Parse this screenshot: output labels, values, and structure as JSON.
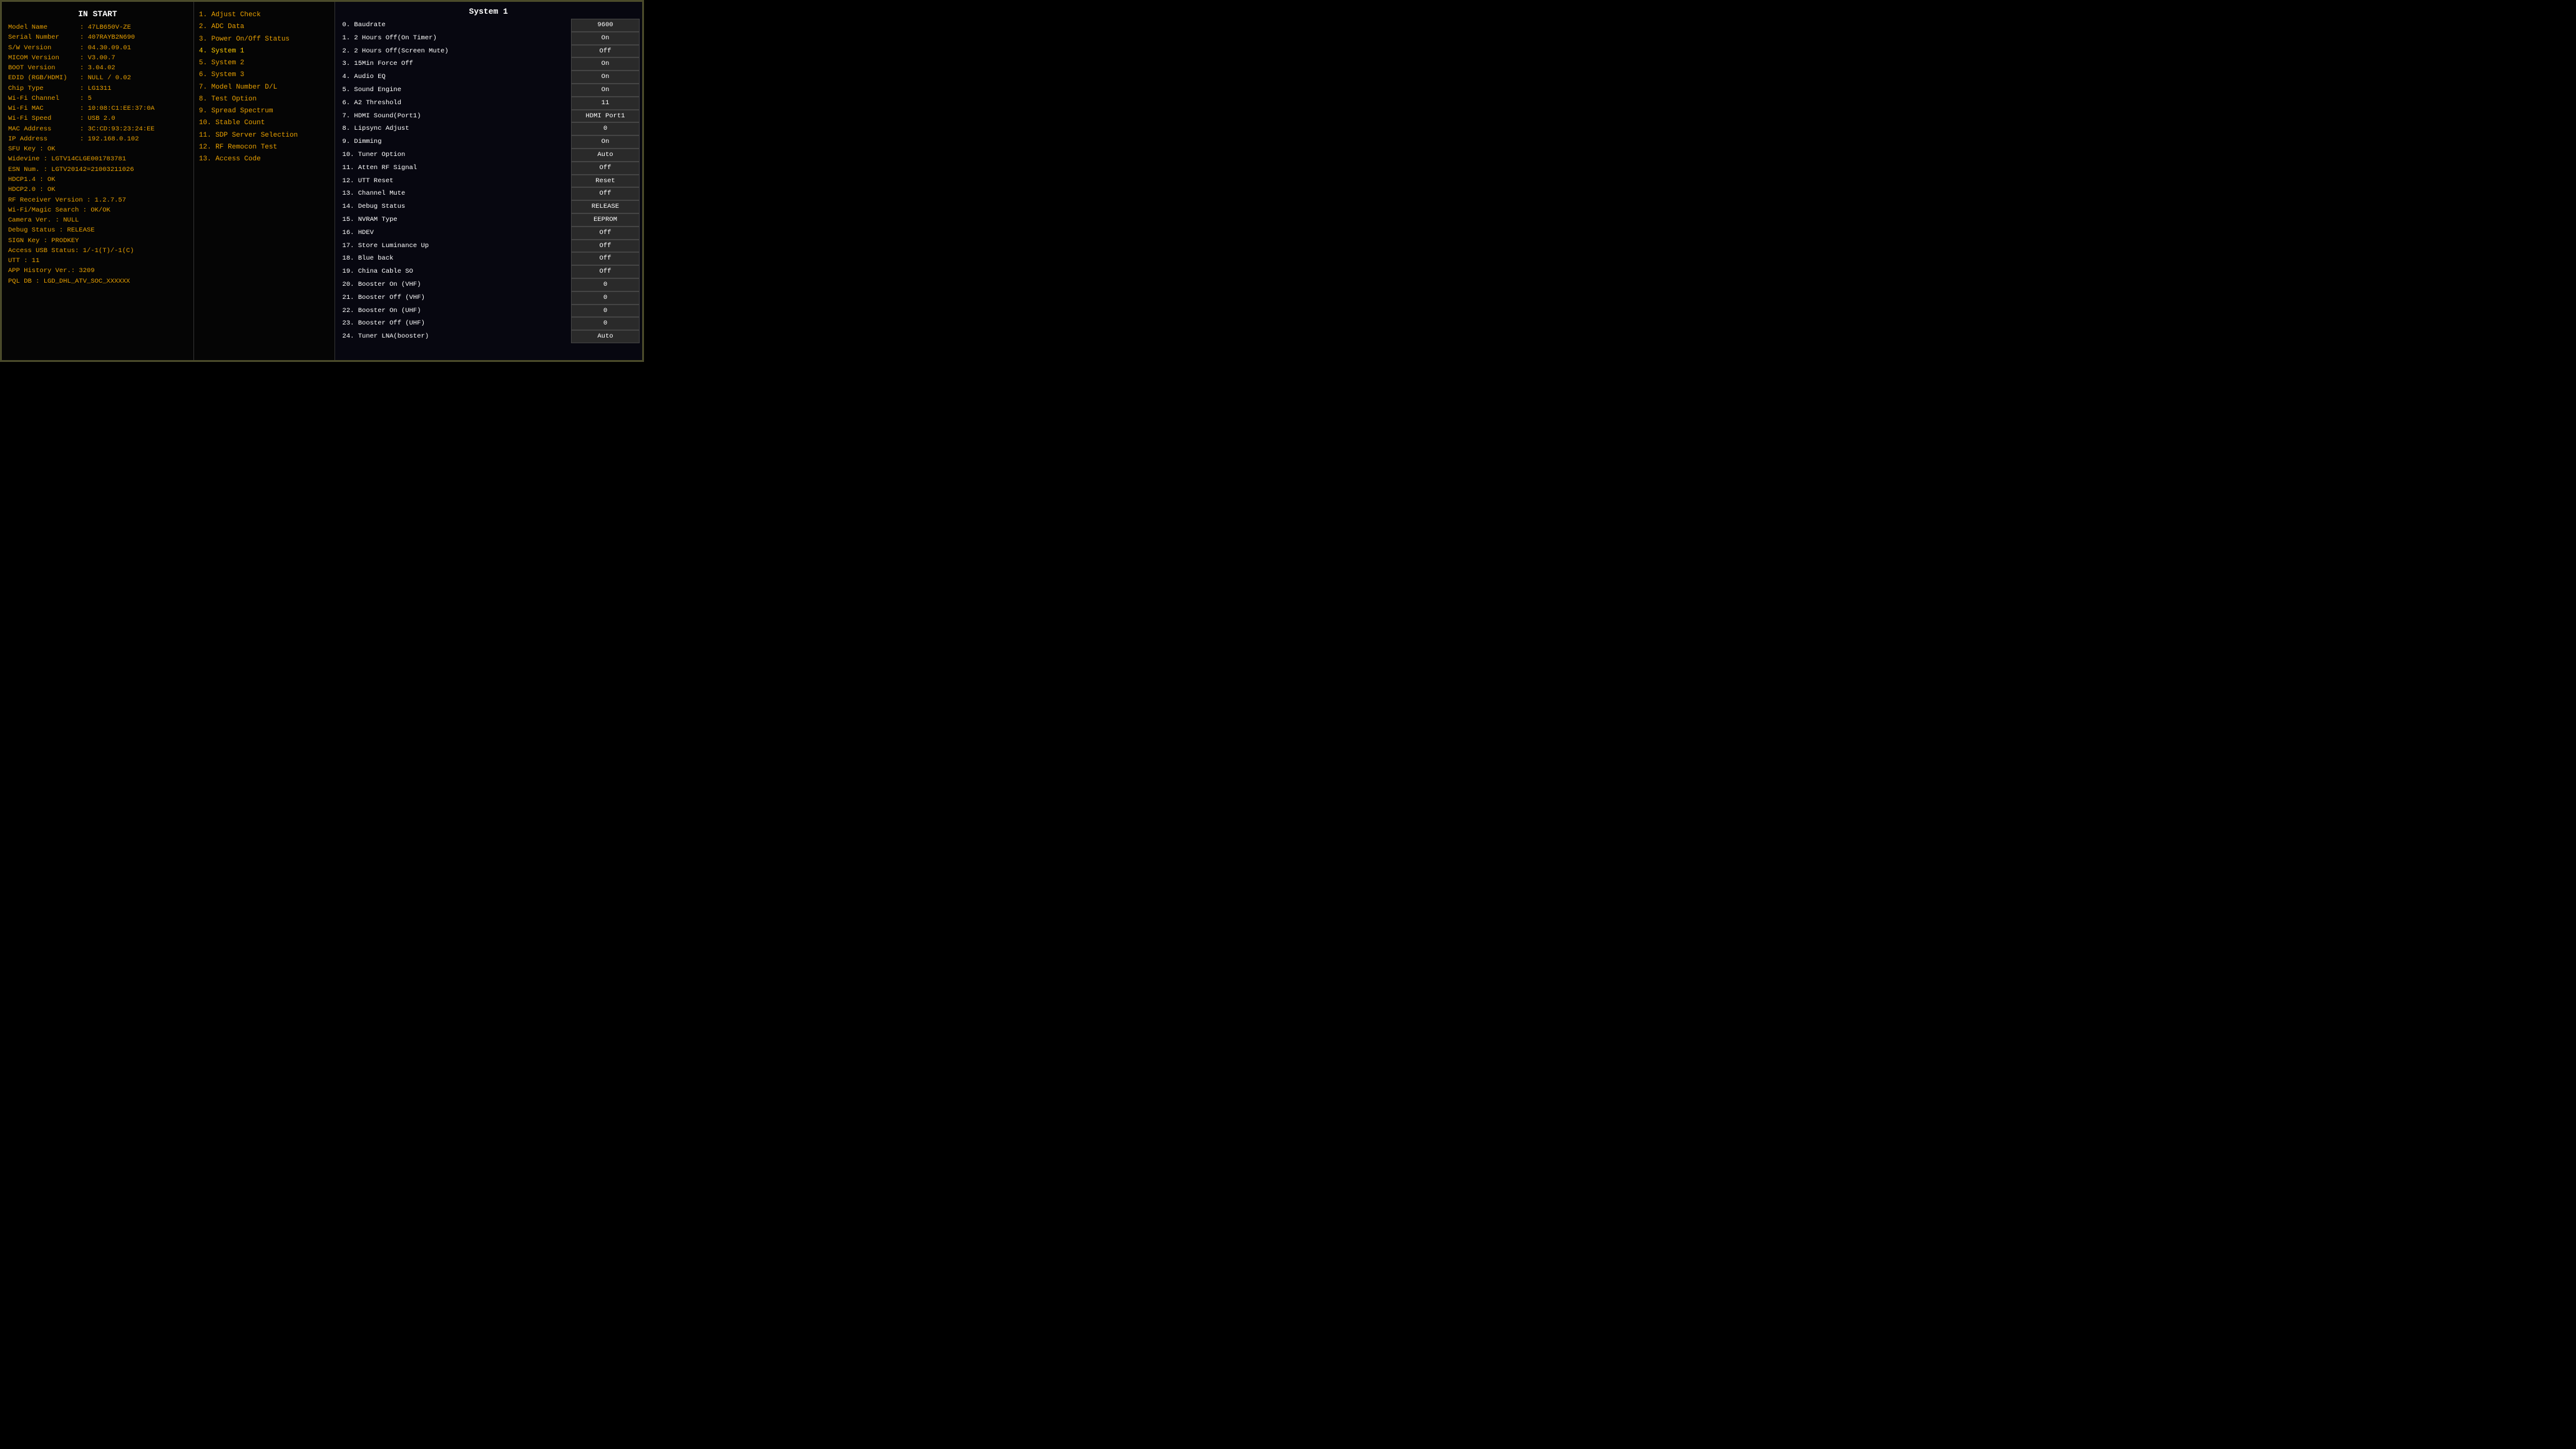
{
  "left": {
    "title": "IN START",
    "rows": [
      {
        "label": "Model Name",
        "value": ": 47LB650V-ZE"
      },
      {
        "label": "Serial Number",
        "value": ": 407RAYB2N690"
      },
      {
        "label": "S/W Version",
        "value": ": 04.30.09.01"
      },
      {
        "label": "MICOM Version",
        "value": ": V3.00.7"
      },
      {
        "label": "BOOT Version",
        "value": ": 3.04.02"
      },
      {
        "label": "EDID (RGB/HDMI)",
        "value": ": NULL / 0.02"
      },
      {
        "label": "Chip Type",
        "value": ": LG1311"
      },
      {
        "label": "Wi-Fi Channel",
        "value": ": 5"
      },
      {
        "label": "Wi-Fi MAC",
        "value": ": 10:08:C1:EE:37:0A"
      },
      {
        "label": "Wi-Fi Speed",
        "value": ": USB 2.0"
      },
      {
        "label": "MAC Address",
        "value": ": 3C:CD:93:23:24:EE"
      },
      {
        "label": "IP Address",
        "value": ": 192.168.0.102"
      }
    ],
    "singles": [
      "SFU Key : OK",
      "Widevine : LGTV14CLGE001783781",
      "ESN Num. : LGTV20142=21003211026",
      "HDCP1.4        : OK",
      "HDCP2.0        : OK",
      "RF Receiver Version  : 1.2.7.57",
      "Wi-Fi/Magic Search  : OK/OK",
      "Camera Ver.    : NULL",
      "Debug Status   : RELEASE",
      "SIGN Key       : PRODKEY",
      "Access USB Status: 1/-1(T)/-1(C)",
      "UTT : 11",
      "APP History Ver.: 3209",
      "PQL DB : LGD_DHL_ATV_SOC_XXXXXX"
    ]
  },
  "middle": {
    "items": [
      {
        "num": "1",
        "label": ". Adjust Check",
        "selected": false
      },
      {
        "num": "2",
        "label": ". ADC Data",
        "selected": false
      },
      {
        "num": "3",
        "label": ". Power On/Off Status",
        "selected": false
      },
      {
        "num": "4",
        "label": ". System 1",
        "selected": true
      },
      {
        "num": "5",
        "label": ". System 2",
        "selected": false
      },
      {
        "num": "6",
        "label": ". System 3",
        "selected": false
      },
      {
        "num": "7",
        "label": ". Model Number D/L",
        "selected": false
      },
      {
        "num": "8",
        "label": ". Test Option",
        "selected": false
      },
      {
        "num": "9",
        "label": ". Spread Spectrum",
        "selected": false
      },
      {
        "num": "10",
        "label": ". Stable Count",
        "selected": false
      },
      {
        "num": "11",
        "label": ". SDP Server Selection",
        "selected": false
      },
      {
        "num": "12",
        "label": ". RF Remocon Test",
        "selected": false
      },
      {
        "num": "13",
        "label": ". Access Code",
        "selected": false
      }
    ]
  },
  "right": {
    "title": "System 1",
    "rows": [
      {
        "label": "0. Baudrate",
        "value": "9600"
      },
      {
        "label": "1. 2 Hours Off(On Timer)",
        "value": "On"
      },
      {
        "label": "2. 2 Hours Off(Screen Mute)",
        "value": "Off"
      },
      {
        "label": "3. 15Min Force Off",
        "value": "On"
      },
      {
        "label": "4. Audio EQ",
        "value": "On"
      },
      {
        "label": "5. Sound Engine",
        "value": "On"
      },
      {
        "label": "6. A2 Threshold",
        "value": "11"
      },
      {
        "label": "7. HDMI Sound(Port1)",
        "value": "HDMI Port1"
      },
      {
        "label": "8. Lipsync Adjust",
        "value": "0"
      },
      {
        "label": "9. Dimming",
        "value": "On"
      },
      {
        "label": "10. Tuner Option",
        "value": "Auto"
      },
      {
        "label": "11. Atten RF Signal",
        "value": "Off"
      },
      {
        "label": "12. UTT Reset",
        "value": "Reset"
      },
      {
        "label": "13. Channel Mute",
        "value": "Off"
      },
      {
        "label": "14. Debug Status",
        "value": "RELEASE"
      },
      {
        "label": "15. NVRAM Type",
        "value": "EEPROM"
      },
      {
        "label": "16. HDEV",
        "value": "Off"
      },
      {
        "label": "17. Store Luminance Up",
        "value": "Off"
      },
      {
        "label": "18. Blue back",
        "value": "Off"
      },
      {
        "label": "19. China Cable SO",
        "value": "Off"
      },
      {
        "label": "20. Booster On (VHF)",
        "value": "0"
      },
      {
        "label": "21. Booster Off (VHF)",
        "value": "0"
      },
      {
        "label": "22. Booster On (UHF)",
        "value": "0"
      },
      {
        "label": "23. Booster Off (UHF)",
        "value": "0"
      },
      {
        "label": "24. Tuner LNA(booster)",
        "value": "Auto"
      }
    ]
  }
}
